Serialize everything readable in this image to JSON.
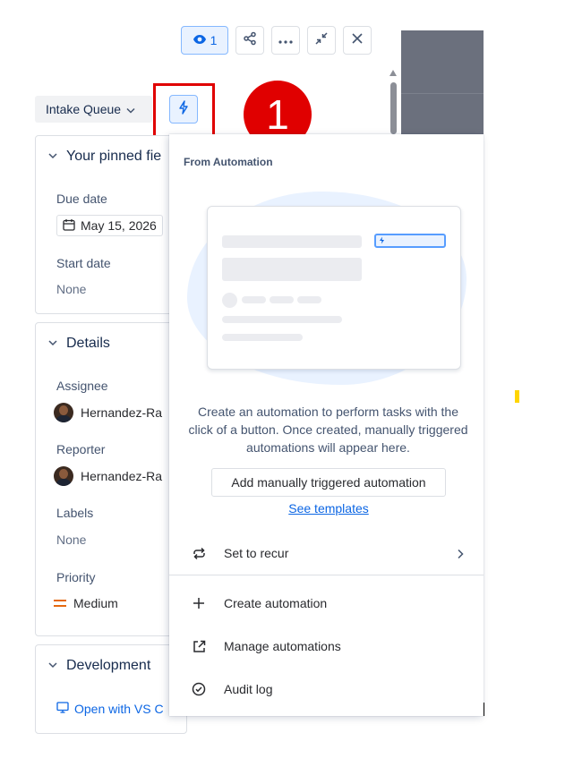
{
  "toolbar": {
    "watchers_count": "1",
    "watch_icon": "eye-icon",
    "share_icon": "share-icon",
    "more_icon": "more-icon",
    "collapse_icon": "collapse-icon",
    "close_icon": "close-icon"
  },
  "queue_dropdown": {
    "label": "Intake Queue"
  },
  "automation_button": {
    "icon": "bolt-icon"
  },
  "annotation": {
    "step": "1",
    "color": "#e00000"
  },
  "pinned_fields": {
    "heading": "Your pinned fie",
    "due_date_label": "Due date",
    "due_date_value": "May 15, 2026",
    "start_date_label": "Start date",
    "start_date_value": "None"
  },
  "details": {
    "heading": "Details",
    "assignee_label": "Assignee",
    "assignee_value": "Hernandez-Ra",
    "reporter_label": "Reporter",
    "reporter_value": "Hernandez-Ra",
    "labels_label": "Labels",
    "labels_value": "None",
    "priority_label": "Priority",
    "priority_value": "Medium"
  },
  "development": {
    "heading": "Development",
    "vscode_link": "Open with VS C"
  },
  "automation_popup": {
    "heading": "From Automation",
    "description": "Create an automation to perform tasks with the click of a button. Once created, manually triggered automations will appear here.",
    "add_button": "Add manually triggered automation",
    "templates_link": "See templates",
    "menu": [
      {
        "label": "Set to recur",
        "icon": "recur-icon"
      },
      {
        "label": "Create automation",
        "icon": "plus-icon"
      },
      {
        "label": "Manage automations",
        "icon": "external-link-icon"
      },
      {
        "label": "Audit log",
        "icon": "check-circle-icon"
      }
    ]
  },
  "colors": {
    "accent": "#0c66e4",
    "priority_medium": "#e56910"
  }
}
